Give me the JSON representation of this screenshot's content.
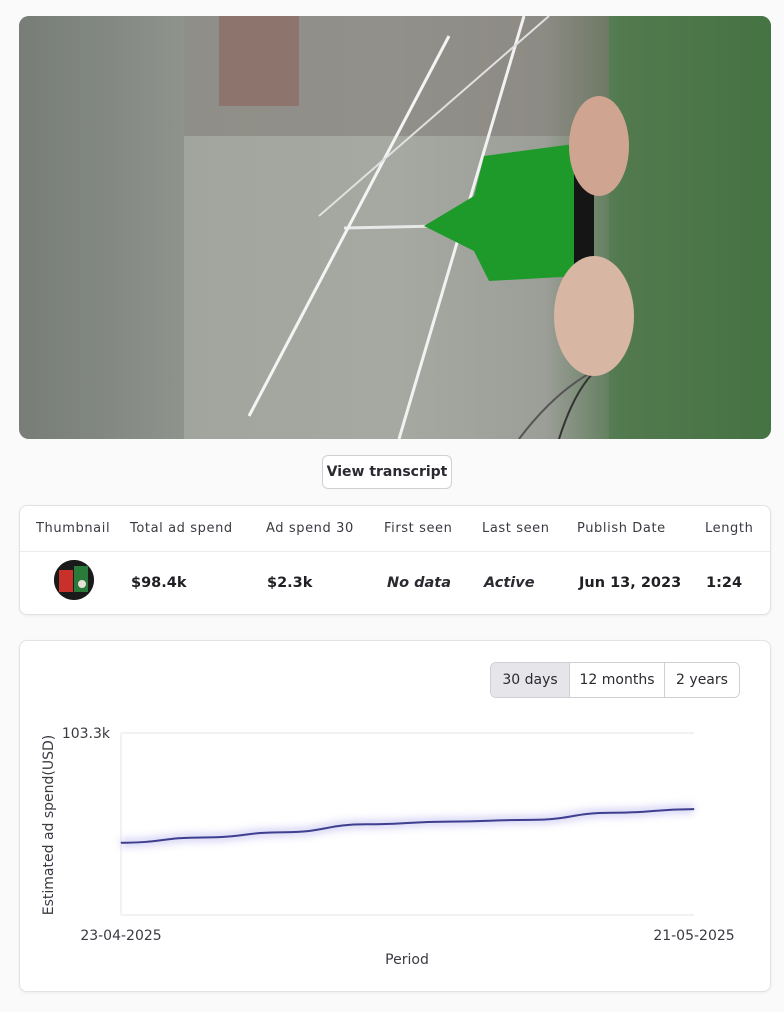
{
  "video": {
    "colors": {
      "green_nozzle": "#1e9a2a",
      "background_gray": "#a4a6a0"
    }
  },
  "transcript_button": {
    "label": "View transcript"
  },
  "table": {
    "headers": [
      "Thumbnail",
      "Total ad spend",
      "Ad spend 30",
      "First seen",
      "Last seen",
      "Publish Date",
      "Length"
    ],
    "row": {
      "total_ad_spend": "$98.4k",
      "ad_spend_30": "$2.3k",
      "first_seen": "No data",
      "last_seen": "Active",
      "publish_date": "Jun 13, 2023",
      "length": "1:24"
    }
  },
  "range_tabs": [
    {
      "label": "30 days",
      "active": true
    },
    {
      "label": "12 months",
      "active": false
    },
    {
      "label": "2 years",
      "active": false
    }
  ],
  "chart_data": {
    "type": "line",
    "ylabel": "Estimated ad spend(USD)",
    "xlabel": "Period",
    "y_tick_labels": [
      "103.3k"
    ],
    "x_tick_labels": [
      "23-04-2025",
      "21-05-2025"
    ],
    "ylim": [
      0,
      103300
    ],
    "x": [
      "23-04-2025",
      "27-04-2025",
      "01-05-2025",
      "05-05-2025",
      "09-05-2025",
      "13-05-2025",
      "17-05-2025",
      "21-05-2025"
    ],
    "series": [
      {
        "values": [
          41000,
          44000,
          47000,
          51500,
          53000,
          54000,
          58000,
          60100
        ]
      }
    ],
    "colors": {
      "line": "#3f3f8f",
      "glow": "#c9c6f2"
    },
    "grid": true
  }
}
